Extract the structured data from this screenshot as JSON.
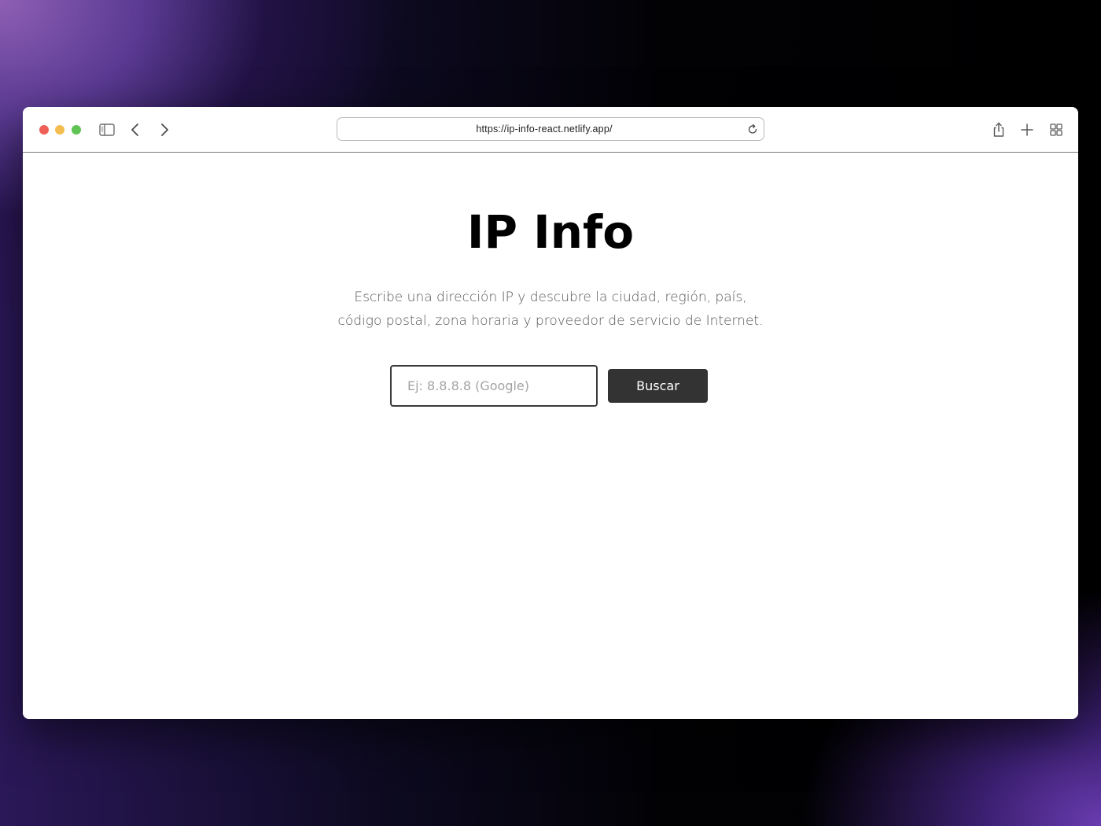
{
  "browser": {
    "url": "https://ip-info-react.netlify.app/"
  },
  "page": {
    "title": "IP Info",
    "description_line1": "Escribe una dirección IP y descubre la ciudad, región, país,",
    "description_line2": "código postal, zona horaria y proveedor de servicio de Internet.",
    "search": {
      "value": "",
      "placeholder": "Ej: 8.8.8.8 (Google)",
      "button_label": "Buscar"
    }
  },
  "colors": {
    "button_bg": "#333333",
    "traffic_red": "#ed5f57",
    "traffic_yellow": "#f4bd4f",
    "traffic_green": "#5fc454"
  }
}
